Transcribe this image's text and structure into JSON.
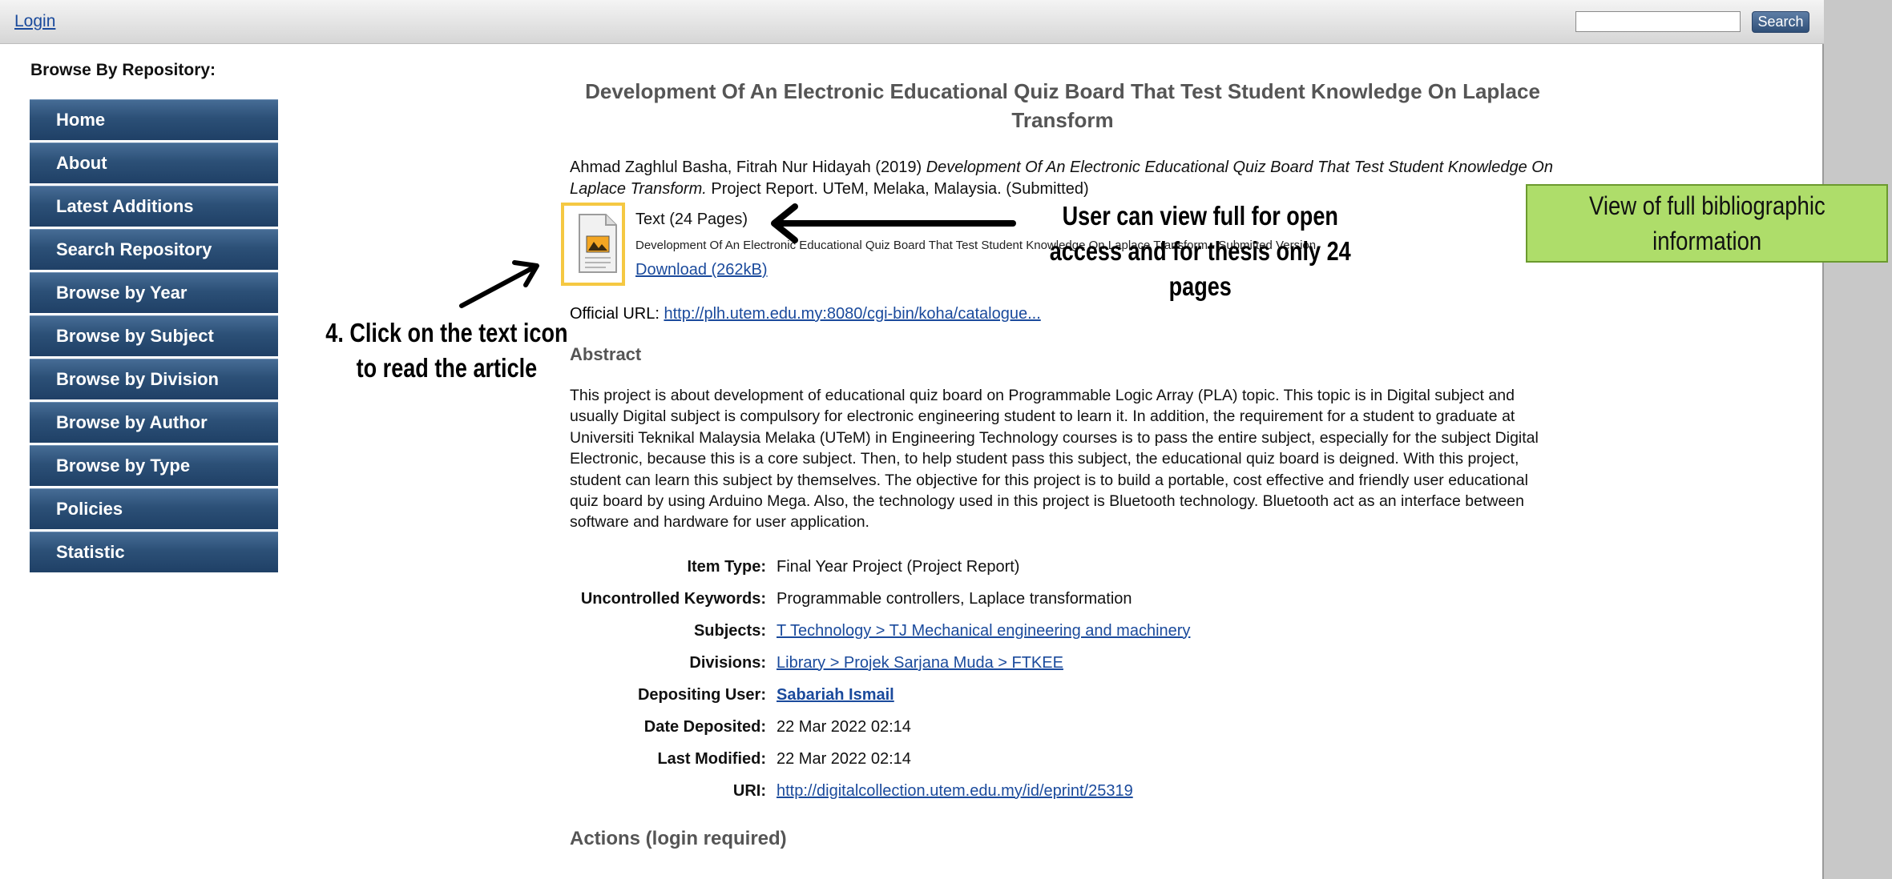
{
  "topbar": {
    "login": "Login",
    "search_value": "",
    "search_button": "Search"
  },
  "sidebar": {
    "heading": "Browse By Repository:",
    "items": [
      "Home",
      "About",
      "Latest Additions",
      "Search Repository",
      "Browse by Year",
      "Browse by Subject",
      "Browse by Division",
      "Browse by Author",
      "Browse by Type",
      "Policies",
      "Statistic"
    ]
  },
  "eprint": {
    "title": "Development Of An Electronic Educational Quiz Board That Test Student Knowledge On Laplace Transform",
    "citation_authors": "Ahmad Zaghlul Basha, Fitrah Nur Hidayah (2019)",
    "citation_title": "Development Of An Electronic Educational Quiz Board That Test Student Knowledge On Laplace Transform.",
    "citation_rest": "Project Report. UTeM, Melaka, Malaysia. (Submitted)",
    "document": {
      "type": "Text (24 Pages)",
      "filename": "Development Of An Electronic Educational Quiz Board That Test Student Knowledge On Laplace Transform - Submitted Version",
      "download": "Download (262kB)",
      "icon": "document-icon"
    },
    "official_url_label": "Official URL:",
    "official_url": "http://plh.utem.edu.my:8080/cgi-bin/koha/catalogue...",
    "abstract_heading": "Abstract",
    "abstract": "This project is about development of educational quiz board on Programmable Logic Array (PLA) topic. This topic is in Digital subject and usually Digital subject is compulsory for electronic engineering student to learn it. In addition, the requirement for a student to graduate at Universiti Teknikal Malaysia Melaka (UTeM) in Engineering Technology courses is to pass the entire subject, especially for the subject Digital Electronic, because this is a core subject. Then, to help student pass this subject, the educational quiz board is deigned. With this project, student can learn this subject by themselves. The objective for this project is to build a portable, cost effective and friendly user educational quiz board by using Arduino Mega. Also, the technology used in this project is Bluetooth technology. Bluetooth act as an interface between software and hardware for user application.",
    "fields": {
      "item_type_label": "Item Type:",
      "item_type": "Final Year Project (Project Report)",
      "keywords_label": "Uncontrolled Keywords:",
      "keywords": "Programmable controllers, Laplace transformation",
      "subjects_label": "Subjects:",
      "subjects": "T Technology > TJ Mechanical engineering and machinery",
      "divisions_label": "Divisions:",
      "divisions": "Library > Projek Sarjana Muda > FTKEE",
      "depositing_user_label": "Depositing User:",
      "depositing_user": "Sabariah Ismail",
      "date_deposited_label": "Date Deposited:",
      "date_deposited": "22 Mar 2022 02:14",
      "last_modified_label": "Last Modified:",
      "last_modified": "22 Mar 2022 02:14",
      "uri_label": "URI:",
      "uri": "http://digitalcollection.utem.edu.my/id/eprint/25319"
    },
    "actions_heading": "Actions (login required)"
  },
  "annotations": {
    "click_line1": "4. Click on the text icon",
    "click_line2": "to read the article",
    "user_line1": "User can view full for open",
    "user_line2": "access and for thesis only 24",
    "user_line3": "pages",
    "green_line1": "View of full bibliographic",
    "green_line2": "information"
  },
  "colors": {
    "highlight_frame": "#f5c842",
    "green_note": "#aedd6a",
    "nav_bar": "#2c5077",
    "link": "#1a4a9c"
  }
}
